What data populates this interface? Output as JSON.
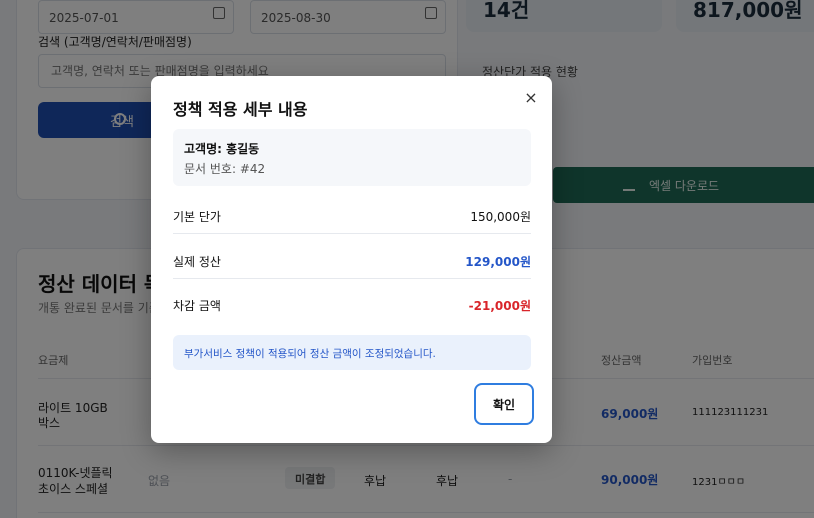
{
  "background": {
    "filters": {
      "start_date": "2025-07-01",
      "end_date": "2025-08-30",
      "search_label": "검색 (고객명/연락처/판매점명)",
      "search_placeholder": "고객명, 연락처 또는 판매점명을 입력하세요",
      "search_button": "검색"
    },
    "stats": {
      "count_value": "14건",
      "amount_value": "817,000원",
      "status_title": "정산단가 적용 현황"
    },
    "excel_download": "엑셀 다운로드",
    "data_section": {
      "title": "정산 데이터 목록",
      "subtitle": "개통 완료된 문서를 기준으로"
    },
    "table": {
      "headers": [
        "요금제",
        "정산금액",
        "가입번호"
      ],
      "rows": [
        {
          "plan_line1": "라이트 10GB",
          "plan_line2": "박스",
          "amount": "69,000원",
          "sub_no": "111123111231"
        },
        {
          "plan_line1": "0110K-넷플릭",
          "plan_line2": "초이스 스페셜",
          "extra": "없음",
          "status": "미결합",
          "col_a": "후납",
          "col_b": "후납",
          "dash": "-",
          "amount": "90,000원",
          "sub_no": "1231ㅁㅁㅁ"
        }
      ]
    }
  },
  "modal": {
    "title": "정책 적용 세부 내용",
    "customer_name": "고객명: 홍길동",
    "document_no": "문서 번호: #42",
    "rows": [
      {
        "label": "기본 단가",
        "value": "150,000원",
        "color": "#111111"
      },
      {
        "label": "실제 정산",
        "value": "129,000원",
        "color": "#2456c8"
      },
      {
        "label": "차감 금액",
        "value": "-21,000원",
        "color": "#d9252a"
      }
    ],
    "notice": "부가서비스 정책이 적용되어 정산 금액이 조정되었습니다.",
    "confirm": "확인",
    "close_icon": "×"
  }
}
